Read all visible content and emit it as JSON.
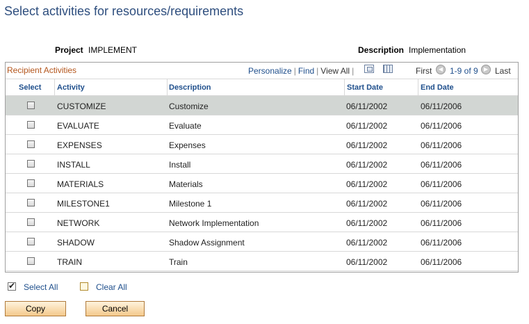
{
  "page": {
    "title": "Select activities for resources/requirements"
  },
  "project": {
    "label": "Project",
    "value": "IMPLEMENT"
  },
  "description": {
    "label": "Description",
    "value": "Implementation"
  },
  "grid": {
    "title": "Recipient Activities",
    "personalize": "Personalize",
    "find": "Find",
    "view_all": "View All",
    "first": "First",
    "range": "1-9 of 9",
    "last": "Last",
    "columns": [
      "Select",
      "Activity",
      "Description",
      "Start Date",
      "End Date"
    ],
    "rows": [
      {
        "activity": "CUSTOMIZE",
        "description": "Customize",
        "start": "06/11/2002",
        "end": "06/11/2006"
      },
      {
        "activity": "EVALUATE",
        "description": "Evaluate",
        "start": "06/11/2002",
        "end": "06/11/2006"
      },
      {
        "activity": "EXPENSES",
        "description": "Expenses",
        "start": "06/11/2002",
        "end": "06/11/2006"
      },
      {
        "activity": "INSTALL",
        "description": "Install",
        "start": "06/11/2002",
        "end": "06/11/2006"
      },
      {
        "activity": "MATERIALS",
        "description": "Materials",
        "start": "06/11/2002",
        "end": "06/11/2006"
      },
      {
        "activity": "MILESTONE1",
        "description": "Milestone 1",
        "start": "06/11/2002",
        "end": "06/11/2006"
      },
      {
        "activity": "NETWORK",
        "description": "Network Implementation",
        "start": "06/11/2002",
        "end": "06/11/2006"
      },
      {
        "activity": "SHADOW",
        "description": "Shadow Assignment",
        "start": "06/11/2002",
        "end": "06/11/2006"
      },
      {
        "activity": "TRAIN",
        "description": "Train",
        "start": "06/11/2002",
        "end": "06/11/2006"
      }
    ]
  },
  "actions": {
    "select_all": "Select All",
    "clear_all": "Clear All",
    "copy": "Copy",
    "cancel": "Cancel"
  },
  "colors": {
    "title": "#2e4e7e",
    "link": "#1f4f8c",
    "grid_title": "#b4561c",
    "selected_row": "#d2d6d3"
  },
  "icons": {
    "zoom": "zoom-icon",
    "grid": "download-grid-icon",
    "prev": "previous-arrow-icon",
    "next": "next-arrow-icon"
  }
}
